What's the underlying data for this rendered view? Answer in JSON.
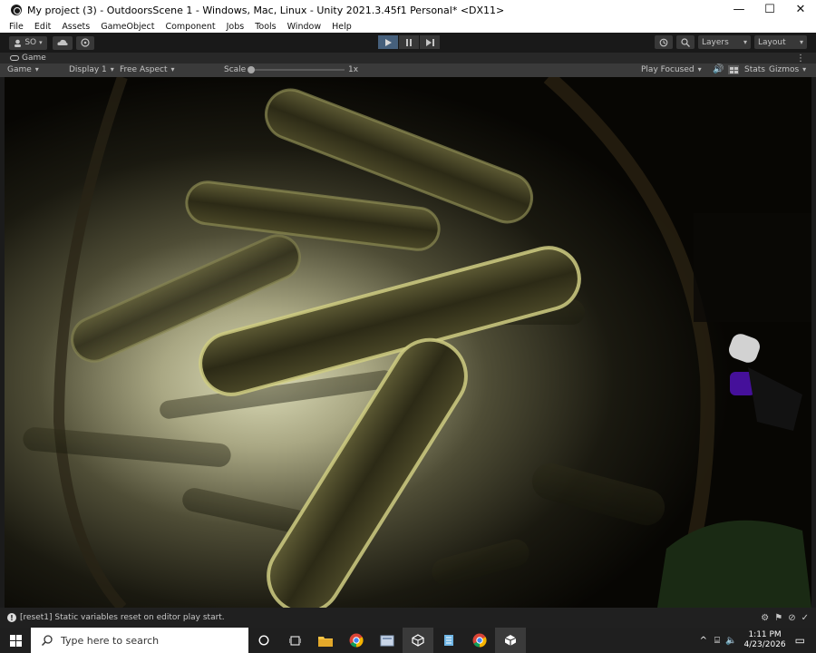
{
  "window": {
    "title": "My project (3) - OutdoorsScene 1 - Windows, Mac, Linux - Unity 2021.3.45f1 Personal* <DX11>",
    "minimize": "—",
    "maximize": "☐",
    "close": "✕"
  },
  "menu": [
    "File",
    "Edit",
    "Assets",
    "GameObject",
    "Component",
    "Jobs",
    "Tools",
    "Window",
    "Help"
  ],
  "toolbar": {
    "account_label": "SO",
    "layers_label": "Layers",
    "layout_label": "Layout"
  },
  "game_tab": {
    "label": "Game"
  },
  "game_bar": {
    "mode": "Game",
    "display": "Display 1",
    "aspect": "Free Aspect",
    "scale_label": "Scale",
    "scale_value": "1x",
    "play_focused": "Play Focused",
    "stats": "Stats",
    "gizmos": "Gizmos"
  },
  "status": {
    "message": "[reset1] Static variables reset on editor play start."
  },
  "taskbar": {
    "search_placeholder": "Type here to search",
    "time": "1:11 PM",
    "date": "4/23/2026"
  },
  "colors": {
    "play_active": "#46607c",
    "editor_bg": "#282828"
  }
}
